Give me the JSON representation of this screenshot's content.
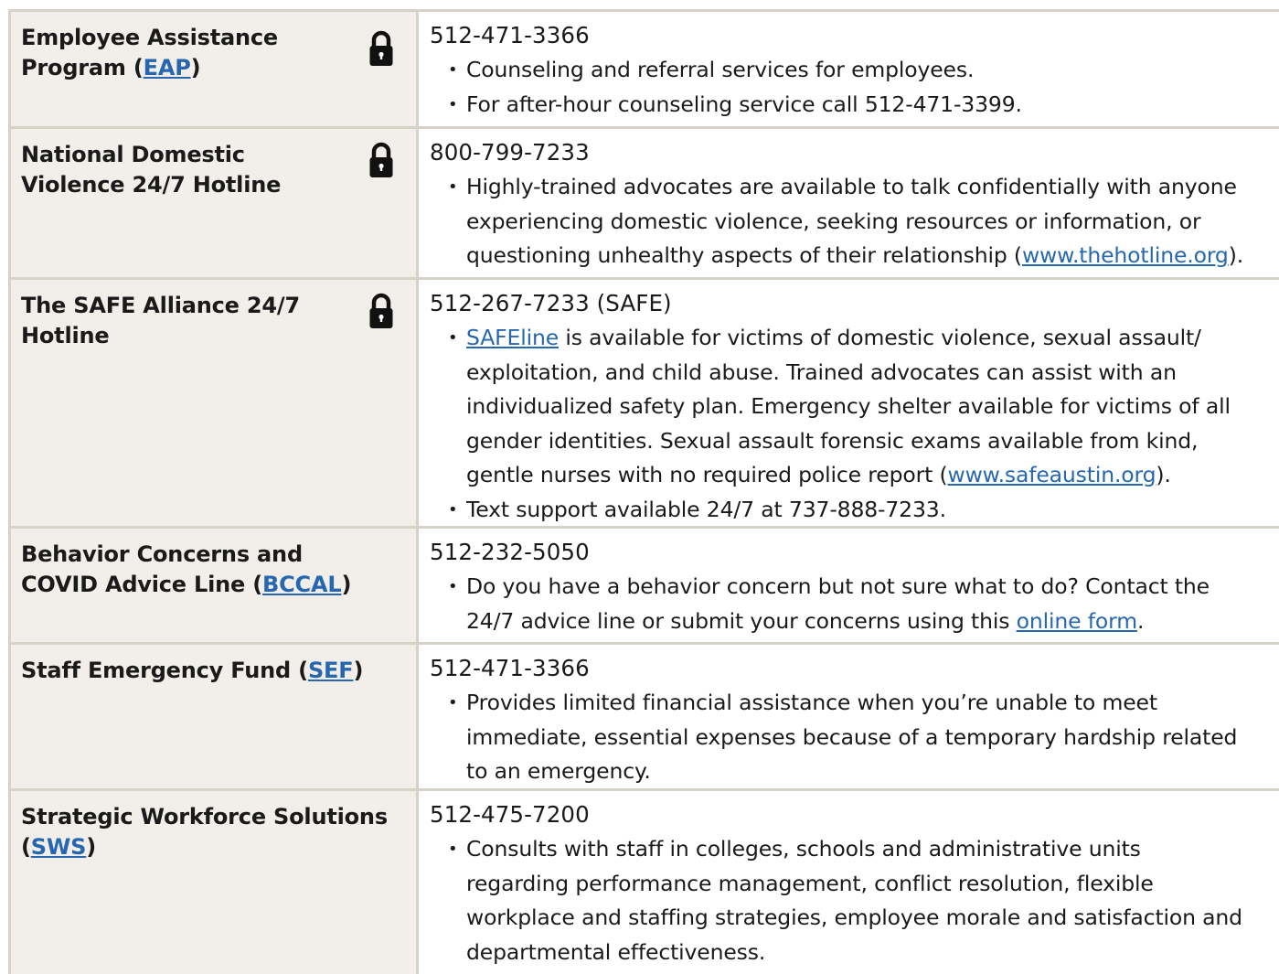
{
  "rows": [
    {
      "name_pre": "Employee Assistance",
      "name_post": "Program (",
      "name_link": "EAP",
      "name_end": ")",
      "phone": "512-471-3366",
      "bullets": [
        "Counseling and referral services for employees.",
        "For after-hour counseling service call 512-471-3399."
      ]
    },
    {
      "name_pre": "National Domestic",
      "name_post": "Violence 24/7 Hotline",
      "phone": "800-799-7233",
      "bullet_lines": [
        "Highly-trained advocates are available to talk confidentially with anyone",
        "experiencing domestic violence, seeking resources or information, or"
      ],
      "bullet_last_pre": "questioning unhealthy aspects of their relationship (",
      "bullet_last_link": "www.thehotline.org",
      "bullet_last_post": ")."
    },
    {
      "name_pre": "The SAFE Alliance 24/7",
      "name_post": "Hotline",
      "phone": "512-267-7233 (SAFE)",
      "b1_link": "SAFEline",
      "b1_first_post": " is available for victims of domestic violence, sexual assault/",
      "b1_lines": [
        "exploitation, and child abuse. Trained advocates can assist with an",
        "individualized safety plan. Emergency shelter available for victims of all",
        "gender identities. Sexual assault forensic exams available from kind,"
      ],
      "b1_last_pre": "gentle nurses with no required police report (",
      "b1_last_link": "www.safeaustin.org",
      "b1_last_post": ").",
      "b2": "Text support available 24/7 at 737-888-7233."
    },
    {
      "name_pre": "Behavior Concerns and",
      "name_post": "COVID Advice Line (",
      "name_link": "BCCAL",
      "name_end": ")",
      "phone": "512-232-5050",
      "b_first": "Do you have a behavior concern but not sure what to do? Contact the",
      "b_last_pre": "24/7 advice line or submit your concerns using this ",
      "b_last_link": "online form",
      "b_last_post": "."
    },
    {
      "name_pre": "Staff Emergency Fund (",
      "name_link": "SEF",
      "name_end": ")",
      "phone": "512-471-3366",
      "bullet_lines": [
        "Provides limited financial assistance when you’re unable to meet",
        "immediate, essential expenses because of a temporary hardship related",
        "to an emergency."
      ]
    },
    {
      "name_pre": "Strategic Workforce Solutions",
      "name_post": "(",
      "name_link": "SWS",
      "name_end": ")",
      "phone": "512-475-7200",
      "bullet_lines": [
        "Consults with staff in colleges, schools and administrative units",
        "regarding performance management, conflict resolution, flexible",
        "workplace and staffing strategies, employee morale and satisfaction and",
        "departmental effectiveness."
      ]
    }
  ],
  "icons": {
    "lock": "lock-icon"
  }
}
